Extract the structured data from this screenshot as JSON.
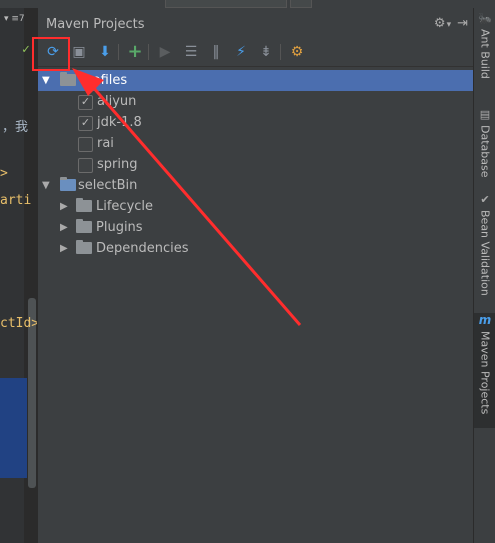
{
  "editor": {
    "fragments": [
      {
        "text": "✓",
        "color": "#8fc05a"
      },
      {
        "text": "，我",
        "color": "#a9b7c6"
      },
      {
        "text": ">",
        "color": "#e8bf6a"
      },
      {
        "text": "arti",
        "color": "#e8bf6a"
      },
      {
        "text": "ctId>",
        "color": "#e8bf6a"
      }
    ],
    "left_tab_label": "▾ ≡7"
  },
  "panel": {
    "title": "Maven Projects",
    "header_icons": [
      "gear-icon",
      "chevron-down-icon",
      "hide-panel-icon"
    ]
  },
  "toolbar": {
    "buttons": [
      {
        "name": "reimport-icon",
        "glyph": "⟳",
        "color": "#4a9eea"
      },
      {
        "name": "generate-sources-icon",
        "glyph": "▣",
        "color": "#8a9099"
      },
      {
        "name": "download-sources-icon",
        "glyph": "⬇",
        "color": "#4a9eea"
      },
      {
        "name": "add-maven-project-icon",
        "glyph": "+",
        "color": "#59a869"
      },
      {
        "name": "run-maven-build-icon",
        "glyph": "▶",
        "color": "#5a5d5f"
      },
      {
        "name": "execute-goal-icon",
        "glyph": "☰",
        "color": "#8a9099"
      },
      {
        "name": "toggle-offline-icon",
        "glyph": "‖",
        "color": "#8a9099"
      },
      {
        "name": "skip-tests-icon",
        "glyph": "⚡",
        "color": "#4a9eea"
      },
      {
        "name": "collapse-all-icon",
        "glyph": "⇟",
        "color": "#8a9099"
      },
      {
        "name": "maven-settings-icon",
        "glyph": "⚙",
        "color": "#e0a040"
      }
    ]
  },
  "tree": {
    "profiles_label": "Profiles",
    "profiles": [
      {
        "label": "aliyun",
        "checked": true
      },
      {
        "label": "jdk-1.8",
        "checked": true
      },
      {
        "label": "rai",
        "checked": false
      },
      {
        "label": "spring",
        "checked": false
      }
    ],
    "project_label": "selectBin",
    "project_children": [
      "Lifecycle",
      "Plugins",
      "Dependencies"
    ]
  },
  "right_tabs": [
    {
      "label": "Ant Build",
      "icon": "ant-icon",
      "glyph": "🐜",
      "active": false
    },
    {
      "label": "Database",
      "icon": "database-icon",
      "glyph": "▤",
      "active": false
    },
    {
      "label": "Bean Validation",
      "icon": "bean-validation-icon",
      "glyph": "✔",
      "active": false
    },
    {
      "label": "Maven Projects",
      "icon": "maven-icon",
      "glyph": "m",
      "active": true
    }
  ],
  "colors": {
    "accent_selection": "#4b6eaf",
    "annotation_red": "#ff2d2d",
    "panel_bg": "#3c3f41"
  }
}
